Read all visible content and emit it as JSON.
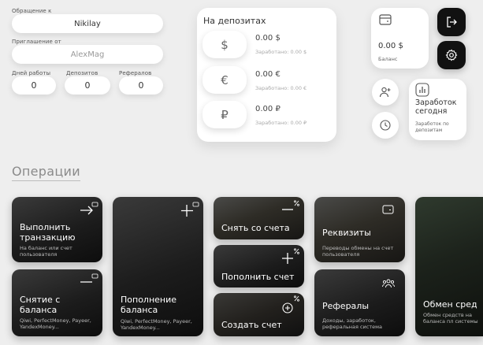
{
  "profile": {
    "referrer_label": "Обращение к",
    "referrer_value": "Nikilay",
    "invited_label": "Приглашение от",
    "invited_value": "AlexMag",
    "stats": [
      {
        "label": "Дней работы",
        "value": "0"
      },
      {
        "label": "Депозитов",
        "value": "0"
      },
      {
        "label": "Рефералов",
        "value": "0"
      }
    ]
  },
  "deposits": {
    "title": "На депозитах",
    "items": [
      {
        "symbol": "$",
        "amount": "0.00 $",
        "earned": "Заработано: 0.00 $"
      },
      {
        "symbol": "€",
        "amount": "0.00 €",
        "earned": "Заработано: 0.00 €"
      },
      {
        "symbol": "₽",
        "amount": "0.00 ₽",
        "earned": "Заработано: 0.00 ₽"
      }
    ]
  },
  "balance": {
    "amount": "0.00 $",
    "label": "Баланс",
    "icon": "wallet-icon"
  },
  "earnings_today": {
    "title": "Заработок сегодня",
    "sub": "Заработок по депозитам",
    "icon": "chart-icon"
  },
  "buttons": {
    "logout_icon": "logout-icon",
    "settings_icon": "gear-icon",
    "add_user_icon": "add-user-icon",
    "history_icon": "clock-icon"
  },
  "operations": {
    "title": "Операции",
    "cards": [
      {
        "id": "transaction",
        "title": "Выполнить транзакцию",
        "sub": "На баланс или счет пользователя",
        "icon": "arrow-right-icon"
      },
      {
        "id": "withdraw",
        "title": "Снятие с баланса",
        "sub": "Qiwi, PerfectMoney, Payeer, YandexMoney...",
        "icon": "minus-icon"
      },
      {
        "id": "topup",
        "title": "Пополнение баланса",
        "sub": "Qiwi, PerfectMoney, Payeer, YandexMoney...",
        "icon": "plus-icon"
      },
      {
        "id": "withdraw-account",
        "title": "Снять со счета",
        "sub": "",
        "icon": "minus-percent-icon"
      },
      {
        "id": "topup-account",
        "title": "Пополнить счет",
        "sub": "",
        "icon": "plus-percent-icon"
      },
      {
        "id": "create-account",
        "title": "Создать счет",
        "sub": "",
        "icon": "add-circle-percent-icon"
      },
      {
        "id": "requisites",
        "title": "Реквизиты",
        "sub": "Переводы обмены на счет пользователя",
        "icon": "wallet-icon"
      },
      {
        "id": "referrals",
        "title": "Рефералы",
        "sub": "Доходы, заработок, реферальная система",
        "icon": "users-icon"
      },
      {
        "id": "exchange",
        "title": "Обмен сред",
        "sub": "Обмен средств на баланса пл системы",
        "icon": ""
      }
    ]
  }
}
